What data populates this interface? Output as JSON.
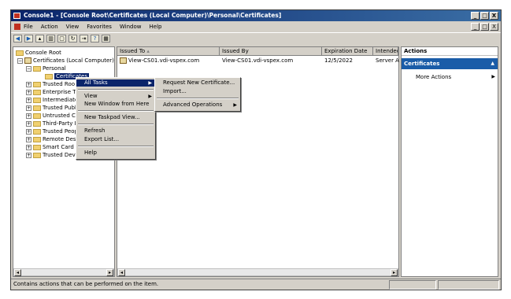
{
  "window": {
    "title": "Console1 - [Console Root\\Certificates (Local Computer)\\Personal\\Certificates]",
    "controls": [
      "_",
      "□",
      "X"
    ],
    "mdi_controls": [
      "_",
      "□",
      "X"
    ]
  },
  "menubar": [
    "File",
    "Action",
    "View",
    "Favorites",
    "Window",
    "Help"
  ],
  "toolbar": [
    "back-icon",
    "forward-icon",
    "up-folder-icon",
    "show-hide-tree-icon",
    "properties-icon",
    "refresh-icon",
    "export-icon",
    "help-icon",
    "show-action-pane-icon"
  ],
  "tree": {
    "root": "Console Root",
    "certs": "Certificates (Local Computer)",
    "personal": "Personal",
    "certificates": "Certificates",
    "items": [
      "Trusted Roo",
      "Enterprise Tr",
      "Intermediate",
      "Trusted Publ",
      "Untrusted Ce",
      "Third-Party I",
      "Trusted Peop",
      "Remote Desk",
      "Smart Card T",
      "Trusted Devices"
    ]
  },
  "list": {
    "columns": [
      "Issued To",
      "Issued By",
      "Expiration Date",
      "Intended"
    ],
    "sort_indicator": "▴",
    "rows": [
      {
        "issued_to": "View-CS01.vdi-vspex.com",
        "issued_by": "View-CS01.vdi-vspex.com",
        "expiration": "12/5/2022",
        "intended": "Server Au"
      }
    ]
  },
  "actions": {
    "header": "Actions",
    "section": "Certificates",
    "items": [
      "More Actions"
    ]
  },
  "context_menu": {
    "items": [
      "All Tasks",
      "View",
      "New Window from Here",
      "New Taskpad View...",
      "Refresh",
      "Export List...",
      "Help"
    ]
  },
  "submenu": {
    "items": [
      "Request New Certificate...",
      "Import...",
      "Advanced Operations"
    ]
  },
  "status": "Contains actions that can be performed on the item."
}
